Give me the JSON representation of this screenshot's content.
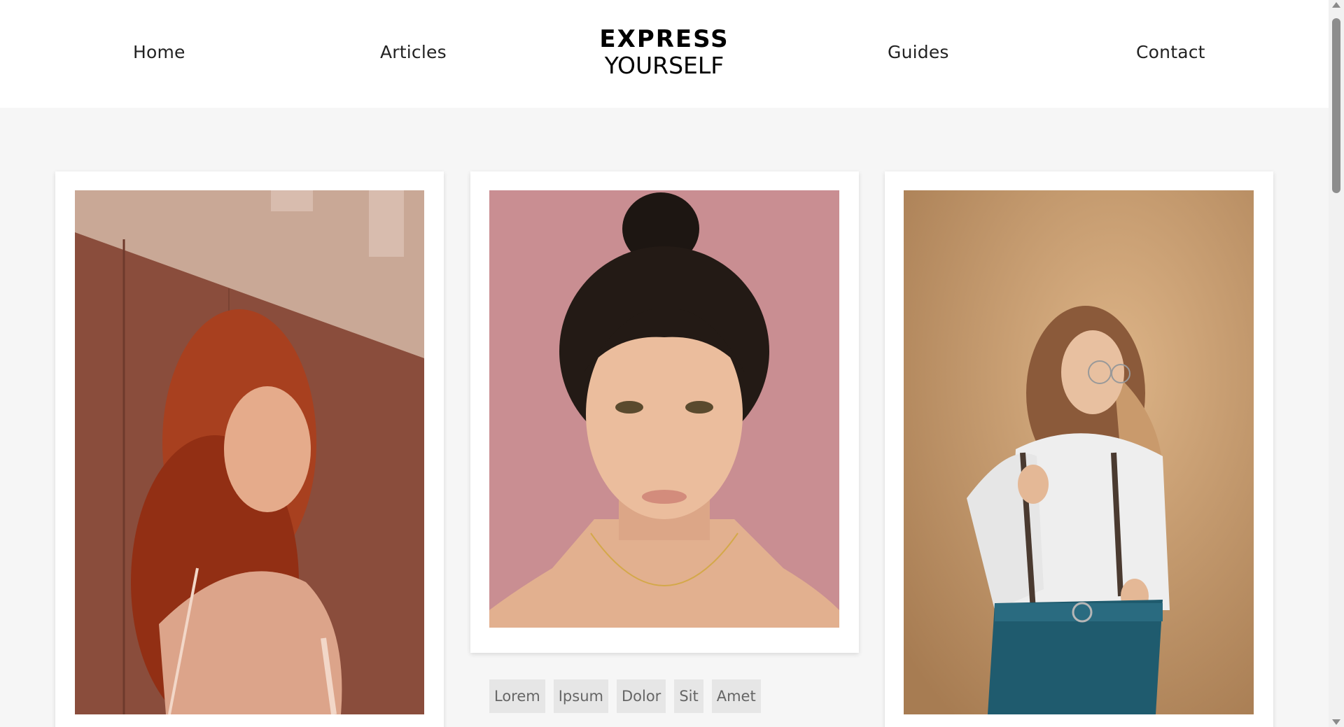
{
  "nav": {
    "home": "Home",
    "articles": "Articles",
    "guides": "Guides",
    "contact": "Contact"
  },
  "logo": {
    "line1": "EXPRESS",
    "line2": "YOURSELF"
  },
  "cards": [
    {
      "image": "portrait-red-hair-woman-photo"
    },
    {
      "image": "portrait-woman-pink-background-photo"
    },
    {
      "image": "portrait-woman-suspenders-glasses-photo"
    }
  ],
  "tags": [
    "Lorem",
    "Ipsum",
    "Dolor",
    "Sit",
    "Amet"
  ],
  "colors": {
    "page_background": "#f6f6f6",
    "header_background": "#ffffff",
    "tag_background": "#e6e6e6",
    "tag_text": "#666666"
  }
}
